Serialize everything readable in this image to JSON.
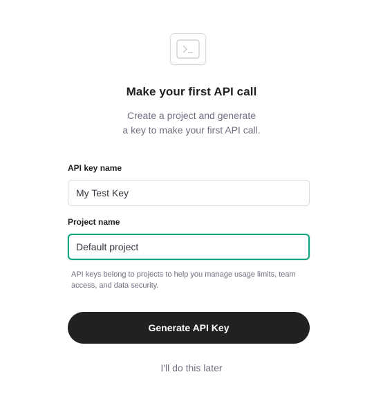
{
  "header": {
    "icon": "terminal-icon",
    "title": "Make your first API call",
    "subtitle_line1": "Create a project and generate",
    "subtitle_line2": "a key to make your first API call."
  },
  "form": {
    "api_key_label": "API key name",
    "api_key_value": "My Test Key",
    "project_label": "Project name",
    "project_value": "Default project",
    "help_text": "API keys belong to projects to help you manage usage limits, team access, and data security."
  },
  "actions": {
    "generate_label": "Generate API Key",
    "later_label": "I'll do this later"
  },
  "colors": {
    "accent": "#10a37f",
    "primary_button": "#202123",
    "muted_text": "#6e6e80"
  }
}
